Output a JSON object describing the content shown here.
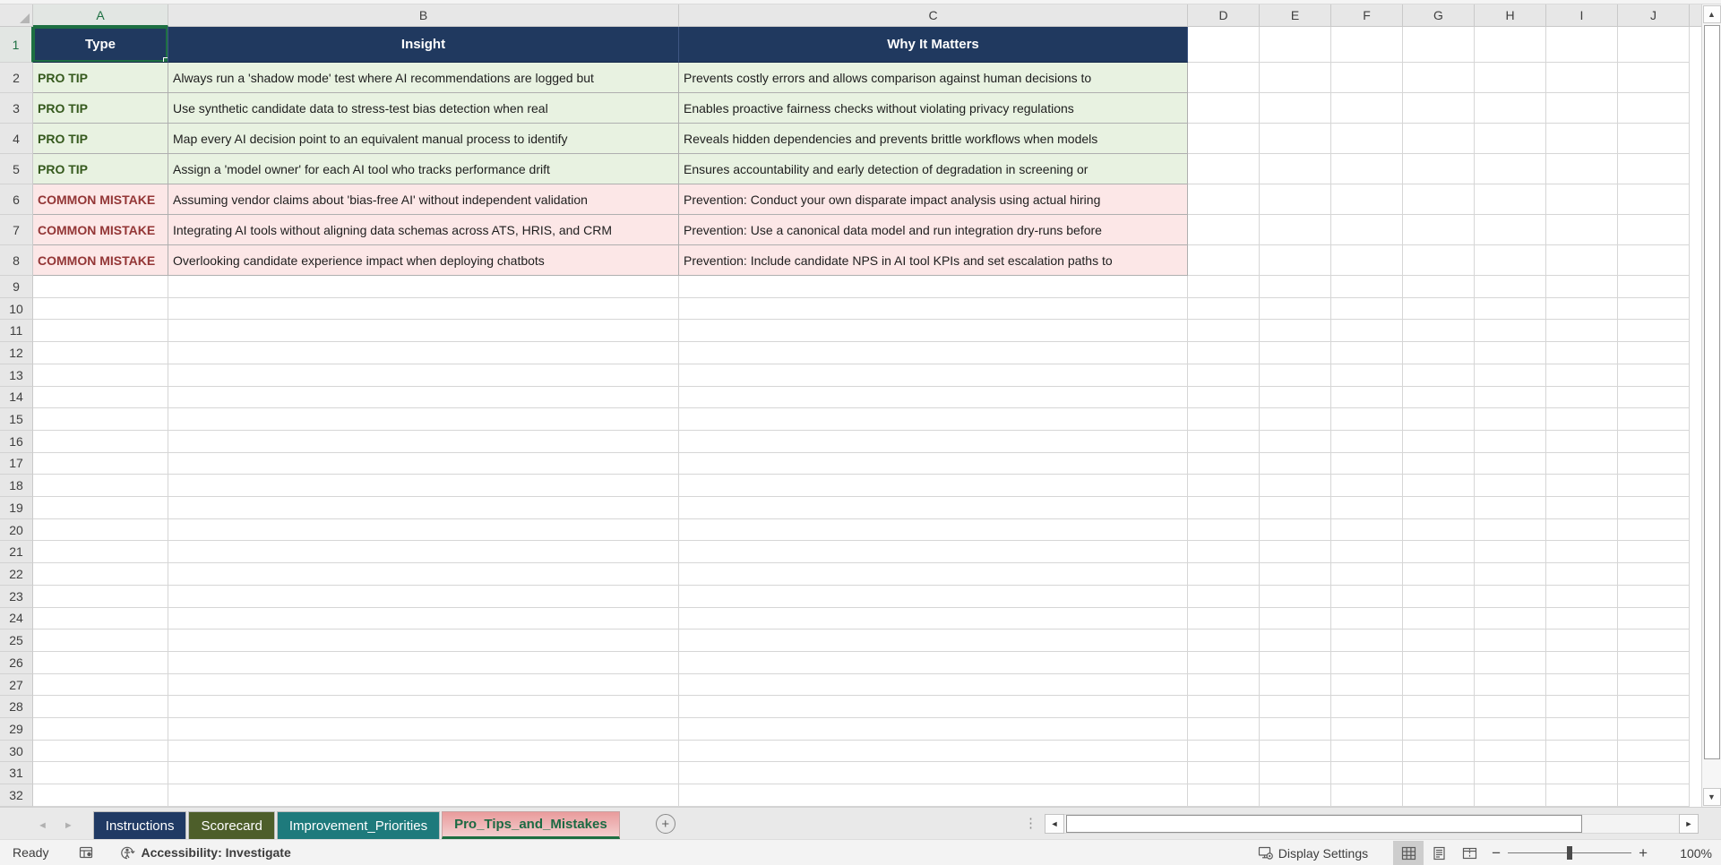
{
  "sheet": {
    "selected_cell": "A1",
    "column_letters": [
      "A",
      "B",
      "C",
      "D",
      "E",
      "F",
      "G",
      "H",
      "I",
      "J"
    ],
    "row_numbers": [
      "1",
      "2",
      "3",
      "4",
      "5",
      "6",
      "7",
      "8",
      "9",
      "10",
      "11",
      "12",
      "13",
      "14",
      "15",
      "16",
      "17",
      "18",
      "19",
      "20",
      "21",
      "22",
      "23",
      "24",
      "25",
      "26",
      "27",
      "28",
      "29",
      "30",
      "31",
      "32"
    ],
    "headers": [
      "Type",
      "Insight",
      "Why It Matters"
    ],
    "rows": [
      {
        "kind": "tip",
        "type": "PRO TIP",
        "insight": "Always run a 'shadow mode' test where AI recommendations are logged but",
        "why": "Prevents costly errors and allows comparison against human decisions to"
      },
      {
        "kind": "tip",
        "type": "PRO TIP",
        "insight": "Use synthetic candidate data to stress-test bias detection when real",
        "why": "Enables proactive fairness checks without violating privacy regulations"
      },
      {
        "kind": "tip",
        "type": "PRO TIP",
        "insight": "Map every AI decision point to an equivalent manual process to identify",
        "why": "Reveals hidden dependencies and prevents brittle workflows when models"
      },
      {
        "kind": "tip",
        "type": "PRO TIP",
        "insight": "Assign a 'model owner' for each AI tool who tracks performance drift",
        "why": "Ensures accountability and early detection of degradation in screening or"
      },
      {
        "kind": "mistake",
        "type": "COMMON MISTAKE",
        "insight": "Assuming vendor claims about 'bias-free AI' without independent validation",
        "why": "Prevention: Conduct your own disparate impact analysis using actual hiring"
      },
      {
        "kind": "mistake",
        "type": "COMMON MISTAKE",
        "insight": "Integrating AI tools without aligning data schemas across ATS, HRIS, and CRM",
        "why": "Prevention: Use a canonical data model and run integration dry-runs before"
      },
      {
        "kind": "mistake",
        "type": "COMMON MISTAKE",
        "insight": "Overlooking candidate experience impact when deploying chatbots",
        "why": "Prevention: Include candidate NPS in AI tool KPIs and set escalation paths to"
      }
    ]
  },
  "tabs": [
    {
      "label": "Instructions",
      "color": "#203A64",
      "active": false
    },
    {
      "label": "Scorecard",
      "color": "#4D5E2A",
      "active": false
    },
    {
      "label": "Improvement_Priorities",
      "color": "#1E7A7C",
      "active": false
    },
    {
      "label": "Pro_Tips_and_Mistakes",
      "color": "#E99B9C",
      "active": true
    }
  ],
  "status_bar": {
    "ready": "Ready",
    "accessibility": "Accessibility: Investigate",
    "display_settings": "Display Settings",
    "zoom": "100%"
  },
  "glyphs": {
    "tab_nav_left": "◄",
    "tab_nav_right": "►",
    "add_sheet": "+",
    "tab_overflow_dots": "⋮",
    "scroll_left": "◄",
    "scroll_right": "►",
    "scroll_up": "▲",
    "scroll_down": "▼",
    "zoom_out": "−",
    "zoom_in": "+"
  },
  "colors": {
    "header_bg": "#20395F",
    "tip_bg": "#E8F2E1",
    "tip_text": "#35591D",
    "mistake_bg": "#FCE7E7",
    "mistake_text": "#933636",
    "selection_green": "#1D6F42",
    "active_tab_text": "#1C6A43"
  }
}
